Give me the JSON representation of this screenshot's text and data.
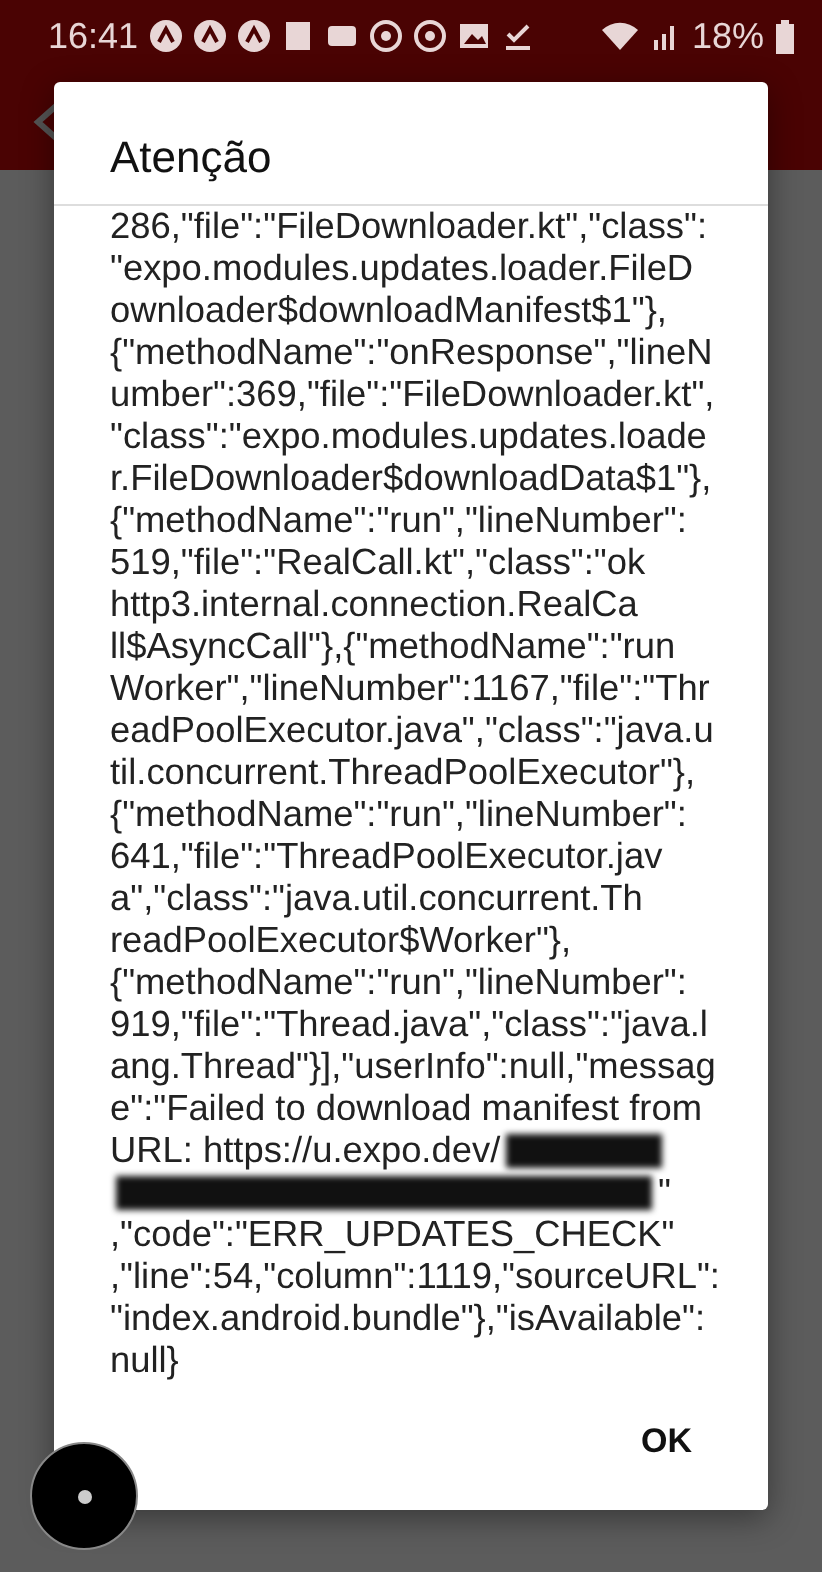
{
  "status_bar": {
    "time": "16:41",
    "battery": "18%"
  },
  "dialog": {
    "title": "Atenção",
    "lines": [
      {
        "text": "286,\"file\":\"FileDownloader.kt\",\"class\":"
      },
      {
        "text": "\"expo.modules.updates.loader.FileD"
      },
      {
        "text": "ownloader$downloadManifest$1\"},"
      },
      {
        "text": "{\"methodName\":\"onResponse\",\"lineN"
      },
      {
        "text": "umber\":369,\"file\":\"FileDownloader.kt\","
      },
      {
        "text": "\"class\":\"expo.modules.updates.loade"
      },
      {
        "text": "r.FileDownloader$downloadData$1\"},"
      },
      {
        "text": "{\"methodName\":\"run\",\"lineNumber\":"
      },
      {
        "text": "519,\"file\":\"RealCall.kt\",\"class\":\"ok"
      },
      {
        "text": "http3.internal.connection.RealCa"
      },
      {
        "text": "ll$AsyncCall\"},{\"methodName\":\"run"
      },
      {
        "text": "Worker\",\"lineNumber\":1167,\"file\":\"Thr"
      },
      {
        "text": "eadPoolExecutor.java\",\"class\":\"java.u"
      },
      {
        "text": "til.concurrent.ThreadPoolExecutor\"},"
      },
      {
        "text": "{\"methodName\":\"run\",\"lineNumber\":"
      },
      {
        "text": "641,\"file\":\"ThreadPoolExecutor.jav"
      },
      {
        "text": "a\",\"class\":\"java.util.concurrent.Th"
      },
      {
        "text": "readPoolExecutor$Worker\"},"
      },
      {
        "text": "{\"methodName\":\"run\",\"lineNumber\":"
      },
      {
        "text": "919,\"file\":\"Thread.java\",\"class\":\"java.l"
      },
      {
        "text": "ang.Thread\"}],\"userInfo\":null,\"messag"
      },
      {
        "text": "e\":\"Failed to download manifest from"
      },
      {
        "text": "URL: https://u.expo.dev/",
        "kind": "masktail"
      },
      {
        "text": "\"",
        "kind": "maskhead"
      },
      {
        "text": ",\"code\":\"ERR_UPDATES_CHECK\""
      },
      {
        "text": ",\"line\":54,\"column\":1119,\"sourceURL\":"
      },
      {
        "text": "\"index.android.bundle\"},\"isAvailable\":"
      },
      {
        "text": "null}"
      }
    ],
    "button": "OK"
  }
}
